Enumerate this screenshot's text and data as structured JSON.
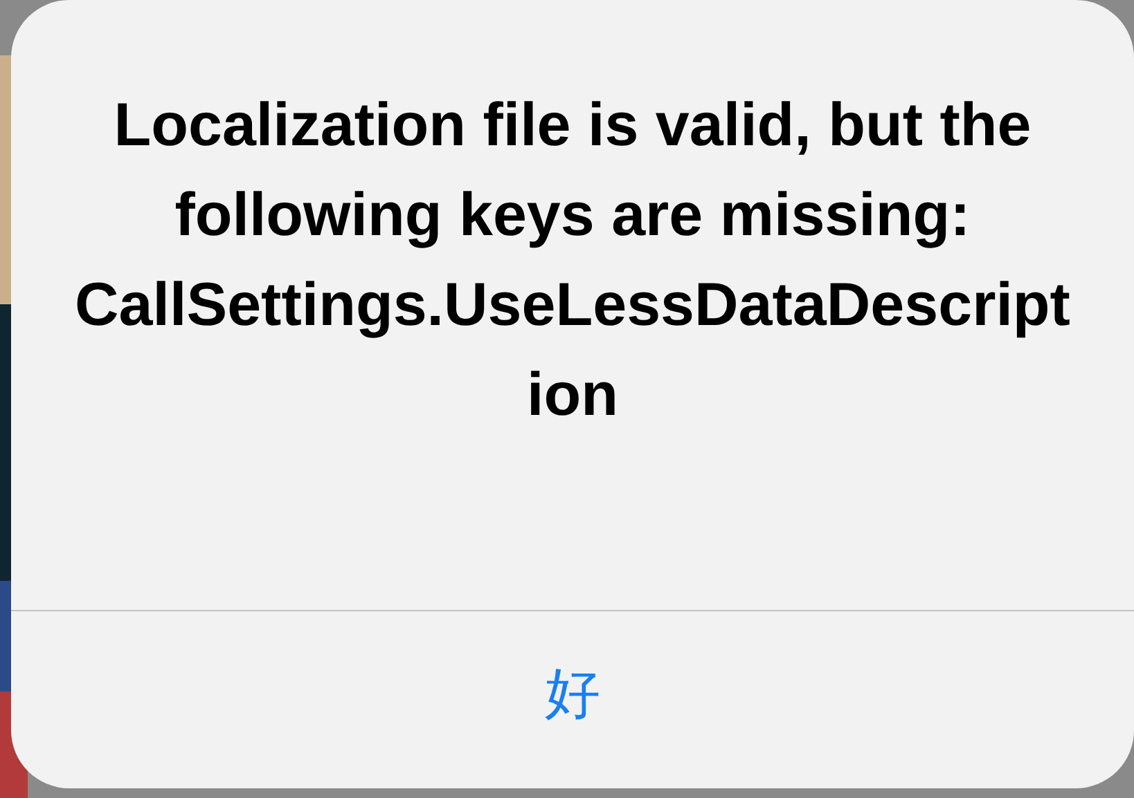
{
  "alert": {
    "message": "Localization file is valid, but the following keys are missing: CallSettings.UseLessDataDescription",
    "buttons": [
      {
        "label": "好"
      }
    ]
  }
}
